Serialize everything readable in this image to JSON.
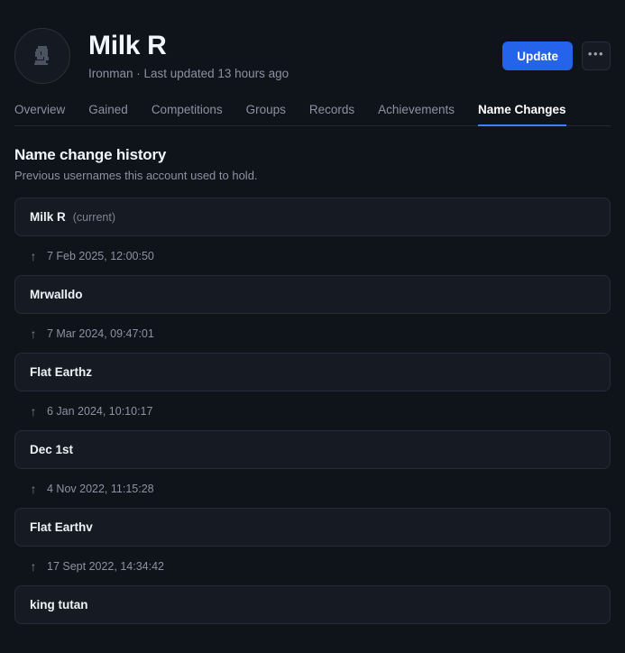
{
  "header": {
    "avatar_icon": "ironman-helmet-icon",
    "player_name": "Milk R",
    "subtitle": "Ironman · Last updated 13 hours ago",
    "update_label": "Update",
    "more_label": "•••"
  },
  "tabs": [
    {
      "label": "Overview",
      "active": false
    },
    {
      "label": "Gained",
      "active": false
    },
    {
      "label": "Competitions",
      "active": false
    },
    {
      "label": "Groups",
      "active": false
    },
    {
      "label": "Records",
      "active": false
    },
    {
      "label": "Achievements",
      "active": false
    },
    {
      "label": "Name Changes",
      "active": true
    }
  ],
  "section": {
    "title": "Name change history",
    "description": "Previous usernames this account used to hold."
  },
  "history": [
    {
      "name": "Milk R",
      "tag": "(current)",
      "date": "7 Feb 2025, 12:00:50"
    },
    {
      "name": "Mrwalldo",
      "tag": "",
      "date": "7 Mar 2024, 09:47:01"
    },
    {
      "name": "Flat Earthz",
      "tag": "",
      "date": "6 Jan 2024, 10:10:17"
    },
    {
      "name": "Dec 1st",
      "tag": "",
      "date": "4 Nov 2022, 11:15:28"
    },
    {
      "name": "Flat Earthv",
      "tag": "",
      "date": "17 Sept 2022, 14:34:42"
    },
    {
      "name": "king tutan",
      "tag": "",
      "date": ""
    }
  ],
  "colors": {
    "background": "#0f131a",
    "card": "#161b23",
    "card_border": "#252c37",
    "accent": "#2563eb",
    "tab_underline": "#3b82f6",
    "text_primary": "#f2f5f9",
    "text_muted": "#8b93a1"
  }
}
